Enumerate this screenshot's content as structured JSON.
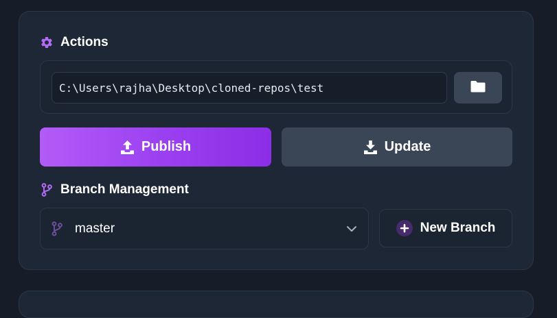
{
  "actions": {
    "title": "Actions",
    "title_icon": "gear-icon",
    "path_value": "C:\\Users\\rajha\\Desktop\\cloned-repos\\test",
    "browse_icon": "folder-icon",
    "publish_label": "Publish",
    "publish_icon": "upload-icon",
    "update_label": "Update",
    "update_icon": "download-icon"
  },
  "branch_management": {
    "title": "Branch Management",
    "title_icon": "git-branch-icon",
    "selected_branch": "master",
    "new_branch_label": "New Branch",
    "new_branch_icon": "plus-circle-icon"
  },
  "colors": {
    "accent": "#a855f7",
    "background": "#161d29",
    "card": "#1e2735",
    "secondary_button": "#3a4556"
  }
}
